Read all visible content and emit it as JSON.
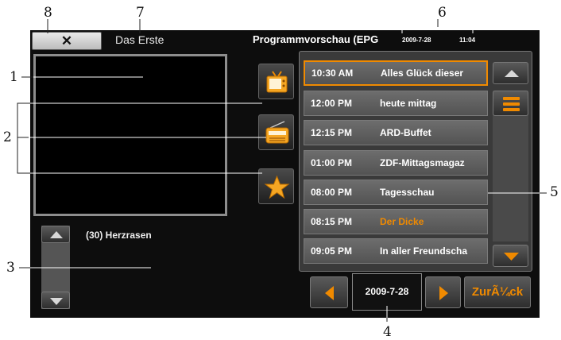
{
  "callouts": [
    "1",
    "2",
    "3",
    "4",
    "5",
    "6",
    "7",
    "8"
  ],
  "header": {
    "close_glyph": "✕",
    "channel": "Das Erste",
    "title": "Programmvorschau (EPG",
    "date": "2009-7-28",
    "time": "11:04"
  },
  "description": {
    "title": "(30) Herzrasen"
  },
  "programs": [
    {
      "time": "10:30 AM",
      "name": "Alles Glück dieser",
      "selected": true
    },
    {
      "time": "12:00 PM",
      "name": "heute mittag"
    },
    {
      "time": "12:15 PM",
      "name": "ARD-Buffet"
    },
    {
      "time": "01:00 PM",
      "name": "ZDF-Mittagsmagaz"
    },
    {
      "time": "08:00 PM",
      "name": "Tagesschau"
    },
    {
      "time": "08:15 PM",
      "name": "Der Dicke",
      "highlight": true
    },
    {
      "time": "09:05 PM",
      "name": "In aller Freundscha"
    }
  ],
  "footer": {
    "date": "2009-7-28",
    "back_label": "ZurÃ¼ck"
  },
  "colors": {
    "accent": "#f08a00",
    "screen_bg": "#0d0d0d"
  },
  "icons": [
    "tv-icon",
    "radio-icon",
    "star-icon",
    "scroll-up-icon",
    "scroll-down-icon",
    "scroll-menu-icon",
    "prev-arrow-icon",
    "next-arrow-icon"
  ]
}
